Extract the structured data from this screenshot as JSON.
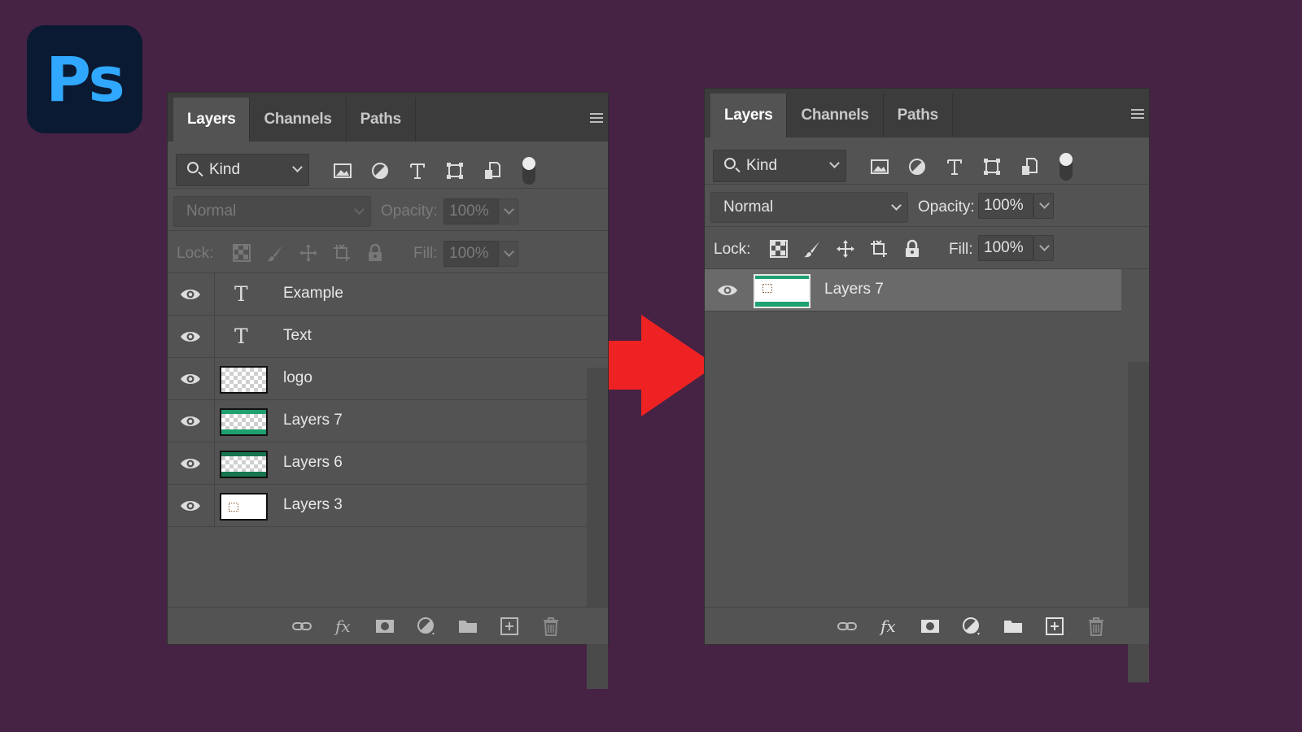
{
  "logo": {
    "text": "Ps"
  },
  "panels": {
    "before": {
      "tabs": [
        "Layers",
        "Channels",
        "Paths"
      ],
      "filter": {
        "kind_label": "Kind"
      },
      "blend_mode": "Normal",
      "opacity_label": "Opacity:",
      "opacity_value": "100%",
      "lock_label": "Lock:",
      "fill_label": "Fill:",
      "fill_value": "100%",
      "layers": [
        {
          "name": "Example",
          "kind": "text"
        },
        {
          "name": "Text",
          "kind": "text"
        },
        {
          "name": "logo",
          "kind": "image"
        },
        {
          "name": "Layers 7",
          "kind": "image"
        },
        {
          "name": "Layers 6",
          "kind": "image"
        },
        {
          "name": "Layers 3",
          "kind": "image"
        }
      ]
    },
    "after": {
      "tabs": [
        "Layers",
        "Channels",
        "Paths"
      ],
      "filter": {
        "kind_label": "Kind"
      },
      "blend_mode": "Normal",
      "opacity_label": "Opacity:",
      "opacity_value": "100%",
      "lock_label": "Lock:",
      "fill_label": "Fill:",
      "fill_value": "100%",
      "layers": [
        {
          "name": "Layers 7",
          "kind": "image",
          "selected": true
        }
      ]
    }
  },
  "colors": {
    "background": "#462345",
    "panel": "#535353",
    "arrow": "#ee2222",
    "ps_blue": "#31a8ff"
  },
  "icons": [
    "search-icon",
    "image-filter-icon",
    "adjustment-filter-icon",
    "type-filter-icon",
    "shape-filter-icon",
    "smart-object-filter-icon",
    "filter-toggle-icon",
    "lock-transparent-icon",
    "lock-brush-icon",
    "lock-move-icon",
    "lock-artboard-icon",
    "lock-all-icon",
    "eye-icon",
    "link-icon",
    "fx-icon",
    "mask-icon",
    "adjustment-icon",
    "folder-icon",
    "new-layer-icon",
    "trash-icon",
    "panel-menu-icon"
  ]
}
